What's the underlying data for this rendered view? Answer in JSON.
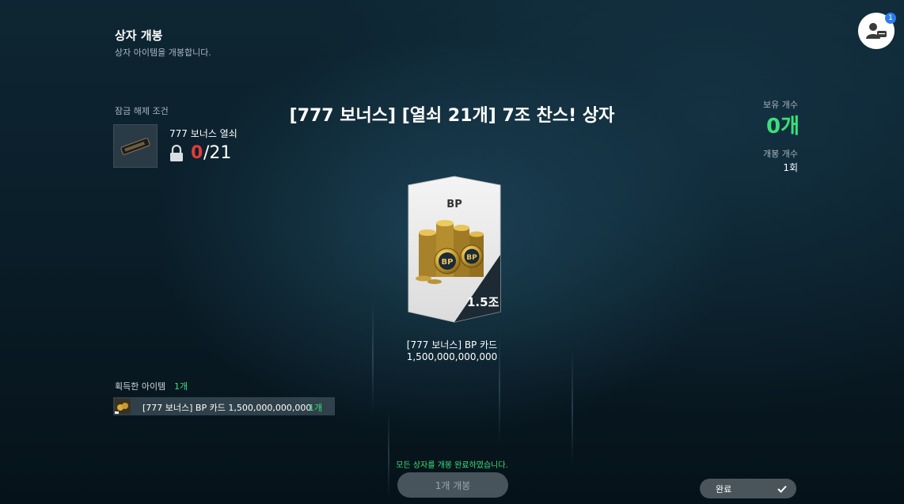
{
  "header": {
    "title": "상자 개봉",
    "subtitle": "상자 아이템을 개봉합니다."
  },
  "profile": {
    "icon": "user-chat-icon",
    "badge_count": "1"
  },
  "unlock": {
    "label": "잠금 해제 조건",
    "key_name": "777 보너스 열쇠",
    "current": "0",
    "total": "/21",
    "icon": "lock-icon"
  },
  "box": {
    "title": "[777 보너스] [열쇠 21개] 7조 찬스! 상자"
  },
  "stats": {
    "own_label": "보유 개수",
    "own_value": "0개",
    "open_label": "개봉 개수",
    "open_value": "1회"
  },
  "card": {
    "tag": "BP",
    "amount": "1.5조",
    "name": "[777 보너스] BP 카드",
    "value": "1,500,000,000,000"
  },
  "acquired": {
    "label": "획득한 아이템",
    "count": "1개",
    "items": [
      {
        "name": "[777 보너스] BP 카드 1,500,000,000,000",
        "qty": "1개"
      }
    ]
  },
  "footer": {
    "message": "모든 상자를 개봉 완료하였습니다.",
    "open_button": "1개 개봉",
    "complete_button": "완료",
    "complete_icon": "check-icon"
  },
  "colors": {
    "accent_green": "#3be07a",
    "key_red": "#e53a3a",
    "badge_blue": "#2a7df0"
  }
}
